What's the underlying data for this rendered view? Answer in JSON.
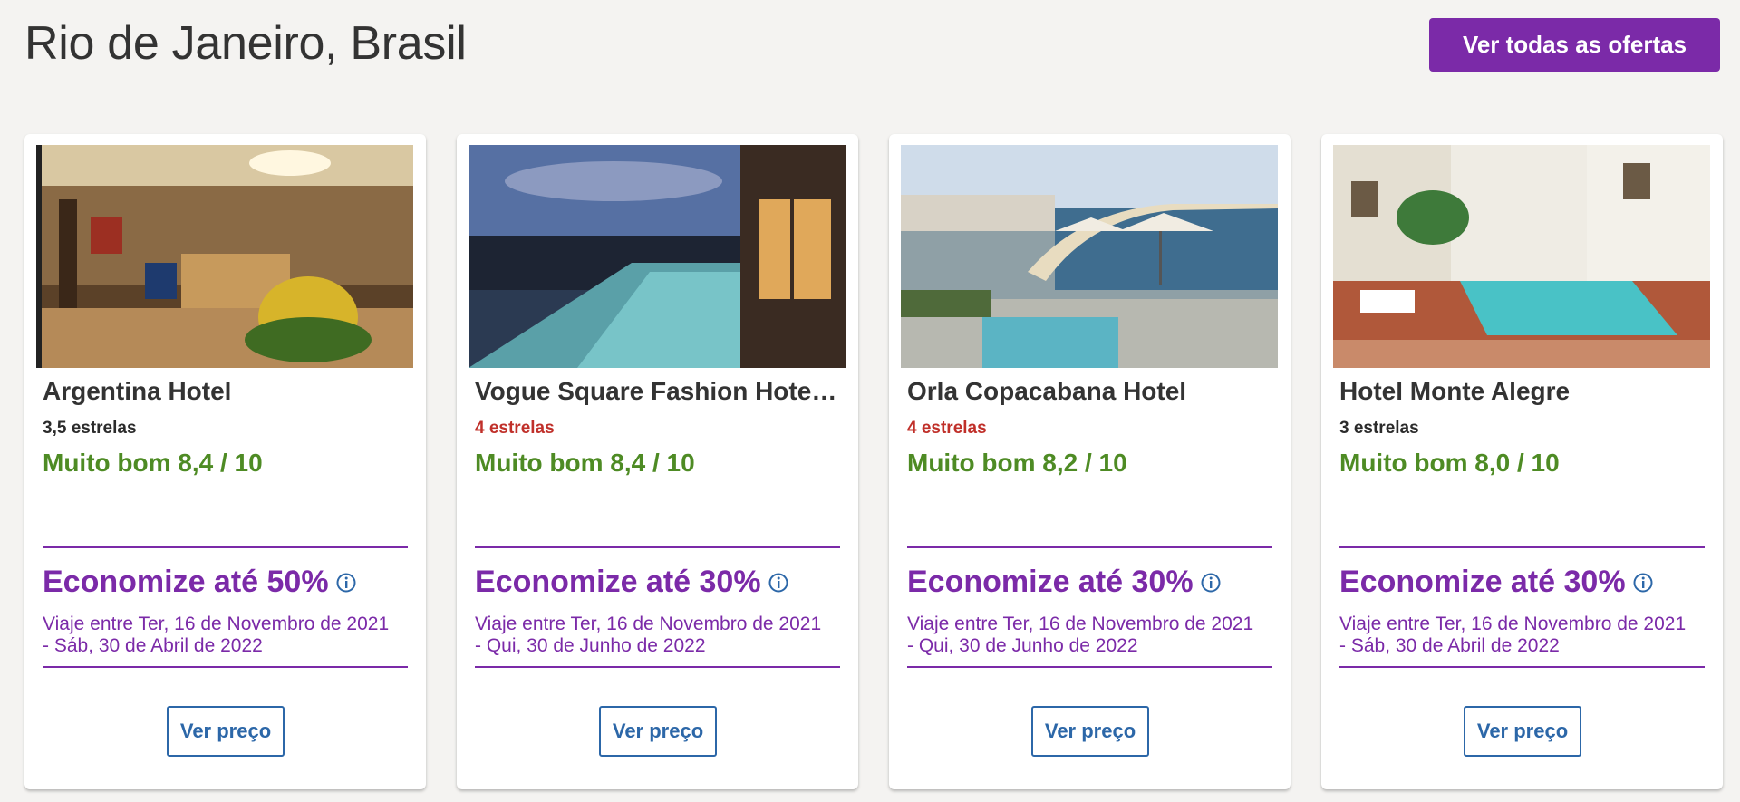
{
  "header": {
    "title": "Rio de Janeiro, Brasil",
    "all_offers_label": "Ver todas as ofertas"
  },
  "colors": {
    "accent": "#7b2aa8",
    "rating_green": "#4e8b24",
    "stars_red": "#c0302a",
    "link_blue": "#2c67a8"
  },
  "hotels": [
    {
      "name": "Argentina Hotel",
      "stars": "3,5 estrelas",
      "rating": "Muito bom 8,4 / 10",
      "savings": "Economize até 50%",
      "dates_line1": "Viaje entre Ter, 16 de Novembro de 2021",
      "dates_line2": "- Sáb, 30 de Abril de 2022",
      "button": "Ver preço"
    },
    {
      "name": "Vogue Square Fashion Hotel…",
      "stars": "4 estrelas",
      "rating": "Muito bom 8,4 / 10",
      "savings": "Economize até 30%",
      "dates_line1": "Viaje entre Ter, 16 de Novembro de 2021",
      "dates_line2": "- Qui, 30 de Junho de 2022",
      "button": "Ver preço"
    },
    {
      "name": "Orla Copacabana Hotel",
      "stars": "4 estrelas",
      "rating": "Muito bom 8,2 / 10",
      "savings": "Economize até 30%",
      "dates_line1": "Viaje entre Ter, 16 de Novembro de 2021",
      "dates_line2": "- Qui, 30 de Junho de 2022",
      "button": "Ver preço"
    },
    {
      "name": "Hotel Monte Alegre",
      "stars": "3 estrelas",
      "rating": "Muito bom 8,0 / 10",
      "savings": "Economize até 30%",
      "dates_line1": "Viaje entre Ter, 16 de Novembro de 2021",
      "dates_line2": "- Sáb, 30 de Abril de 2022",
      "button": "Ver preço"
    }
  ]
}
